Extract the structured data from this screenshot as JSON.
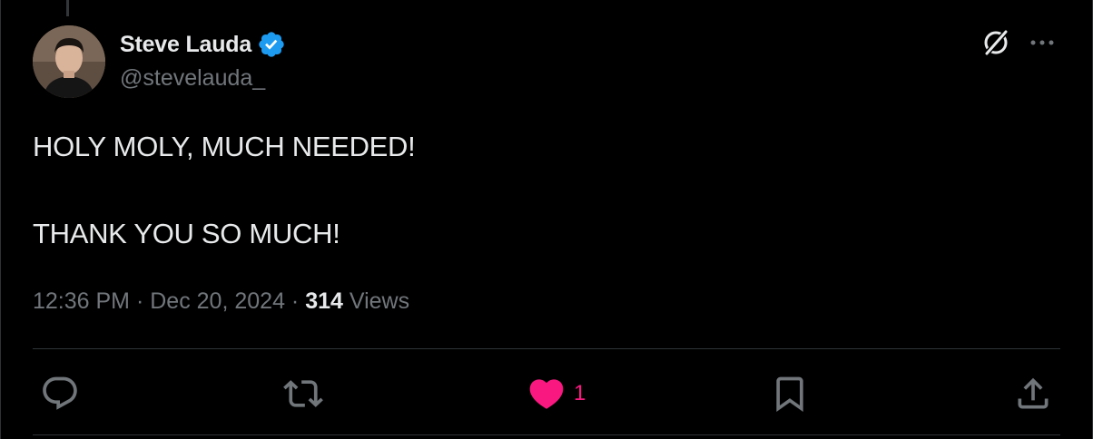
{
  "tweet": {
    "author": {
      "display_name": "Steve Lauda",
      "handle": "@stevelauda_",
      "verified": true,
      "avatar_icon": "avatar-photo"
    },
    "text_lines": [
      "HOLY MOLY, MUCH NEEDED!",
      "THANK YOU SO MUCH!"
    ],
    "time": "12:36 PM",
    "separator": "·",
    "date": "Dec 20, 2024",
    "views_count": "314",
    "views_label": "Views"
  },
  "actions": {
    "reply": {
      "icon": "reply-icon"
    },
    "retweet": {
      "icon": "retweet-icon"
    },
    "like": {
      "icon": "heart-filled-icon",
      "count": "1",
      "liked": true
    },
    "bookmark": {
      "icon": "bookmark-icon"
    },
    "share": {
      "icon": "share-icon"
    }
  },
  "header_icons": {
    "grok": "grok-icon",
    "more": "more-icon"
  },
  "colors": {
    "background": "#000000",
    "text_primary": "#e7e9ea",
    "text_secondary": "#71767b",
    "verified_blue": "#1d9bf0",
    "like_pink": "#f91880",
    "border": "#2f3336"
  }
}
